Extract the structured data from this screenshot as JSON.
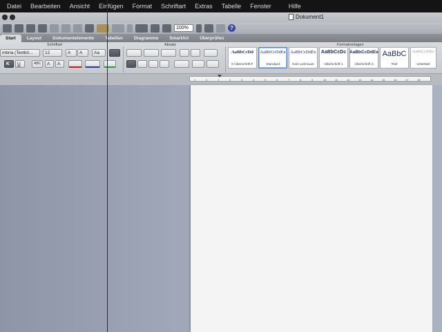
{
  "menu": [
    "Datei",
    "Bearbeiten",
    "Ansicht",
    "Einfügen",
    "Format",
    "Schriftart",
    "Extras",
    "Tabelle",
    "Fenster",
    "Hilfe"
  ],
  "window": {
    "title": "Dokument1"
  },
  "toolbar": {
    "zoom": "100%"
  },
  "ribbon_tabs": [
    "Start",
    "Layout",
    "Dokumentelemente",
    "Tabellen",
    "Diagramme",
    "SmartArt",
    "Überprüfen"
  ],
  "ribbon": {
    "groups": {
      "font": "Schriftart",
      "paragraph": "Absatz",
      "styles": "Formatvorlagen"
    },
    "font_name": "mbria (Textkö...",
    "font_size": "12",
    "bold": "K",
    "underline": "U",
    "strike": "ABC",
    "superscript": "A",
    "subscript": "A",
    "grow": "A",
    "shrink": "A",
    "case": "Aa"
  },
  "styles": [
    {
      "preview": "AaBbCcDd",
      "name": "0 Überschrift F"
    },
    {
      "preview": "AaBbCcDdEe",
      "name": "Standard"
    },
    {
      "preview": "AaBbCcDdEe",
      "name": "Kein Leerraum"
    },
    {
      "preview": "AaBbCcDc",
      "name": "Überschrift 1"
    },
    {
      "preview": "AaBbCcDdEe",
      "name": "Überschrift 2"
    },
    {
      "preview": "AaBbC",
      "name": "Titel"
    },
    {
      "preview": "AaBbCcDdEe",
      "name": "Untertitel"
    }
  ],
  "ruler_ticks": [
    "1",
    "2",
    "1",
    "2",
    "3",
    "4",
    "5",
    "6",
    "7",
    "8",
    "9",
    "10",
    "11",
    "12",
    "13",
    "14",
    "15",
    "16",
    "17",
    "18"
  ]
}
